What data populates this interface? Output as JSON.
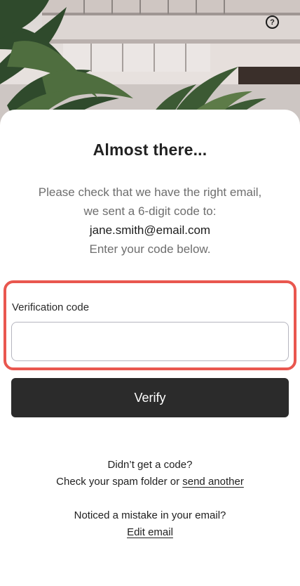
{
  "header": {
    "help_icon": "question-circle-icon",
    "help_glyph": "?"
  },
  "main": {
    "title": "Almost there...",
    "desc_line1": "Please check that we have the right email,",
    "desc_line2": "we sent a 6-digit code to:",
    "email": "jane.smith@email.com",
    "desc_line3": "Enter your code below."
  },
  "form": {
    "code_label": "Verification code",
    "code_value": "",
    "code_placeholder": "",
    "verify_label": "Verify"
  },
  "help": {
    "no_code_title": "Didn’t get a code?",
    "no_code_text": "Check your spam folder or",
    "send_another_link": "send another",
    "mistake_text": "Noticed a mistake in your email?",
    "edit_email_link": "Edit email"
  },
  "colors": {
    "accent_outline": "#e9574f",
    "button_bg": "#2b2b2b",
    "text_muted": "#6e6e6e"
  }
}
